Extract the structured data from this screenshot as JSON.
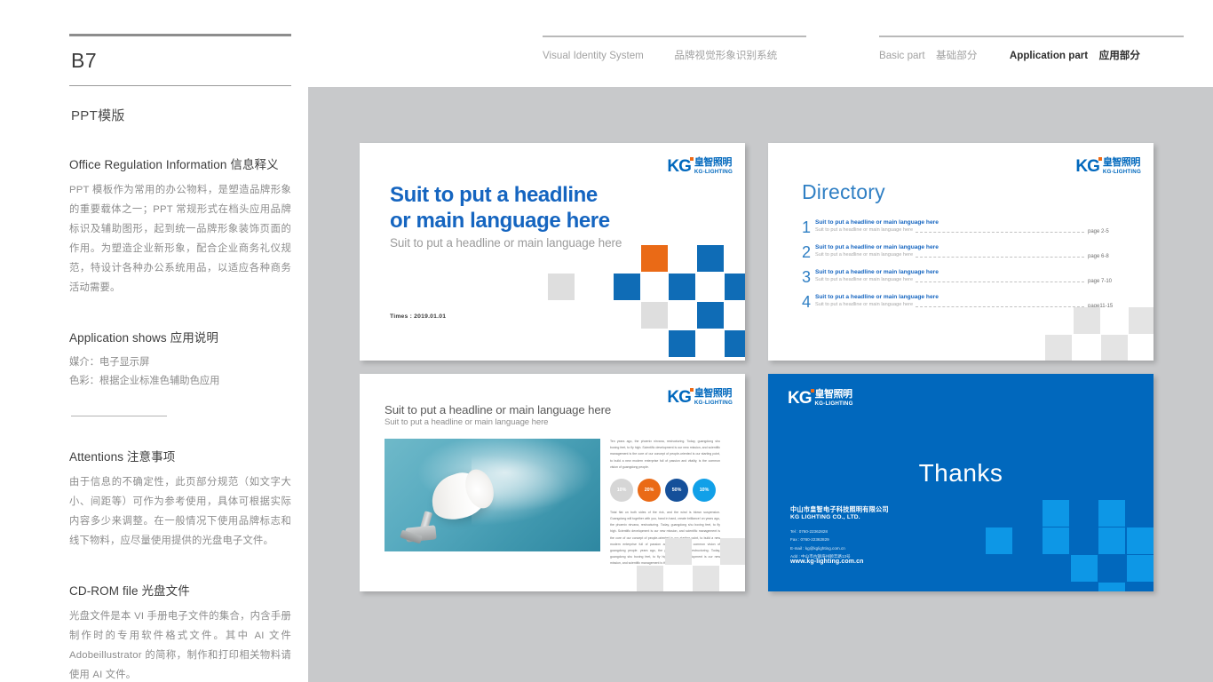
{
  "sidebar": {
    "page_code": "B7",
    "section_label": "PPT模版",
    "blocks": [
      {
        "title": "Office Regulation Information 信息释义",
        "body": "PPT 模板作为常用的办公物料，是塑造品牌形象的重要载体之一；PPT 常规形式在档头应用品牌标识及辅助图形，起到统一品牌形象装饰页面的作用。为塑造企业新形象，配合企业商务礼仪规范，特设计各种办公系统用品，以适应各种商务活动需要。"
      },
      {
        "title": "Application shows 应用说明",
        "line1": "媒介：电子显示屏",
        "line2": "色彩：根据企业标准色辅助色应用"
      },
      {
        "title": "Attentions 注意事项",
        "body": "由于信息的不确定性，此页部分规范（如文字大小、间距等）可作为参考使用，具体可根据实际内容多少来调整。在一般情况下使用品牌标志和线下物料，应尽量使用提供的光盘电子文件。"
      },
      {
        "title": "CD-ROM file 光盘文件",
        "body": "光盘文件是本 VI 手册电子文件的集合，内含手册制作时的专用软件格式文件。其中 AI 文件 Adobeillustrator 的简称，制作和打印相关物料请使用 AI 文件。"
      }
    ]
  },
  "header": {
    "left_en": "Visual Identity System",
    "left_cn": "品牌视觉形象识别系统",
    "right_en": "Basic part",
    "right_cn": "基础部分",
    "right_active_en": "Application part",
    "right_active_cn": "应用部分"
  },
  "logo": {
    "mark": "KG",
    "cn": "皇智照明",
    "en": "KG-LIGHTING"
  },
  "slide1": {
    "headline_line1": "Suit to put a headline",
    "headline_line2": "or main language here",
    "subhead": "Suit to put a headline or main language here",
    "time": "Times : 2019.01.01"
  },
  "slide2": {
    "title": "Directory",
    "items": [
      {
        "num": "1",
        "main": "Suit to put a headline or main language here",
        "sub": "Suit to put a headline or main language here",
        "page": "page 2-5"
      },
      {
        "num": "2",
        "main": "Suit to put a headline or main language here",
        "sub": "Suit to put a headline or main language here",
        "page": "page 6-8"
      },
      {
        "num": "3",
        "main": "Suit to put a headline or main language here",
        "sub": "Suit to put a headline or main language here",
        "page": "page 7-10"
      },
      {
        "num": "4",
        "main": "Suit to put a headline or main language here",
        "sub": "Suit to put a headline or main language here",
        "page": "page11-15"
      }
    ]
  },
  "slide3": {
    "title": "Suit to put a headline or main language here",
    "subtitle": "Suit to put a headline or main language here",
    "paragraph_top": "Ten years ago, the phoenix nirvana, restructuring. Today, guangdong shu boxing feet, to fly high. Scientific development is our new mission, and scientific management is the core of our concept of people-oriented is our starting point, to build a new modern enterprise full of passion and vitality, is the common vision of guangdong people.",
    "paragraph_bottom": "Tidal flat on both sides of the rick, and the wind is blown suspension. Guangdong will together with you, hand in hand, create brilliance! on years ago, the phoenix nirvana, restructuring. Today, guangdong shu boxing feet, to fly high. Scientific development is our new mission, and scientific management is the core of our concept of people-oriented is our starting point, to build a new modern enterprise full of passion and vitality, is the common vision of guangdong people. years ago, the phoenix nirvana, restructuring. Today, guangdong shu boxing feet, to fly high. Scientific development is our new mission, and scientific management is the core of",
    "stats": [
      {
        "label": "10%",
        "color": "#d6d6d6"
      },
      {
        "label": "20%",
        "color": "#ea6a16"
      },
      {
        "label": "50%",
        "color": "#15509a"
      },
      {
        "label": "10%",
        "color": "#11a0e8"
      }
    ]
  },
  "slide4": {
    "thanks": "Thanks",
    "company_cn": "中山市皇智电子科技照明有限公司",
    "company_en": "KG LIGHTING CO., LTD.",
    "tel": "Tel : 0760-22362828",
    "fax": "Fax : 0760-22362829",
    "email": "E-mail : kg@kglighting.com.cn",
    "address": "Add : 中山市古镇海州颐丰路13号",
    "website": "www.kg-lighting.com.cn"
  },
  "colors": {
    "brand_blue": "#0168bd",
    "brand_orange": "#ee6a15",
    "canvas_gray": "#c8c9cb"
  }
}
